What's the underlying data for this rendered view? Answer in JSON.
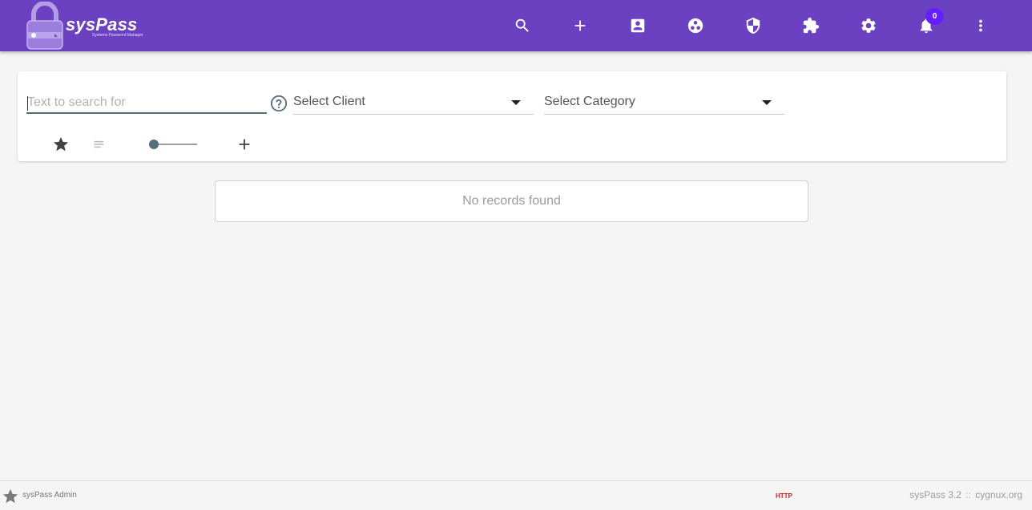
{
  "app": {
    "name": "sysPass",
    "tagline": "Systems Password Manager"
  },
  "header": {
    "icons": [
      "search-icon",
      "add-icon",
      "account-box-icon",
      "groups-icon",
      "security-shield-icon",
      "extension-icon",
      "settings-icon",
      "notifications-icon",
      "more-vert-icon"
    ],
    "notification_count": "0"
  },
  "search": {
    "placeholder": "Text to search for",
    "client_select": "Select Client",
    "category_select": "Select Category"
  },
  "results": {
    "empty_message": "No records found"
  },
  "footer": {
    "user": "sysPass Admin",
    "protocol": "HTTP",
    "version": "sysPass 3.2",
    "separator": "::",
    "site": "cygnux.org"
  },
  "colors": {
    "header_bg": "#6b41c1",
    "badge_bg": "#651fff",
    "accent": "#546e7a",
    "http_warning": "#c62828"
  }
}
